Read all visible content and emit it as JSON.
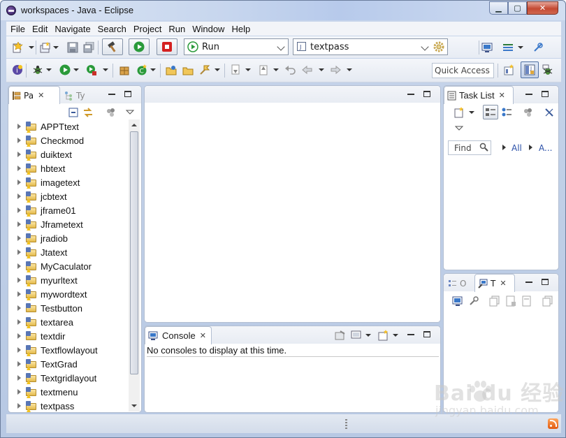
{
  "window": {
    "title": "workspaces - Java - Eclipse",
    "controls": [
      "minimize",
      "maximize",
      "close"
    ]
  },
  "menubar": {
    "items": [
      "File",
      "Edit",
      "Navigate",
      "Search",
      "Project",
      "Run",
      "Window",
      "Help"
    ]
  },
  "toolbar": {
    "launch_mode": "Run",
    "launch_config": "textpass",
    "quick_access_placeholder": "Quick Access"
  },
  "package_explorer": {
    "tab_label": "Pa",
    "inactive_tab_label": "Ty",
    "projects": [
      "APPTtext",
      "Checkmod",
      "duiktext",
      "hbtext",
      "imagetext",
      "jcbtext",
      "jframe01",
      "Jframetext",
      "jradiob",
      "Jtatext",
      "MyCaculator",
      "myurltext",
      "mywordtext",
      "Testbutton",
      "textarea",
      "textdir",
      "Textflowlayout",
      "TextGrad",
      "Textgridlayout",
      "textmenu",
      "textpass"
    ]
  },
  "task_list": {
    "tab_label": "Task List",
    "find_placeholder": "Find",
    "filter_all": "All",
    "filter_activate": "A..."
  },
  "outline": {
    "tab_o": "O",
    "tab_t": "T"
  },
  "console": {
    "tab_label": "Console",
    "message": "No consoles to display at this time."
  },
  "watermark": {
    "brand": "Bai du 经验",
    "url": "jingyan.baidu.com"
  },
  "colors": {
    "frame": "#b7c8e3",
    "panel_border": "#b3bfd2",
    "stop_red": "#d42020",
    "run_green": "#2a9a3a"
  }
}
